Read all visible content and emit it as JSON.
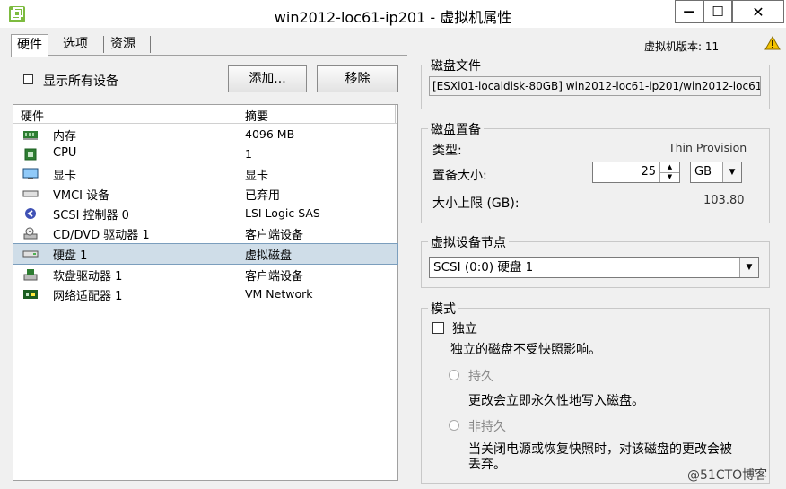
{
  "window": {
    "title": "win2012-loc61-ip201 - 虚拟机属性",
    "minimize_symbol": "—",
    "maximize_symbol": "☐",
    "close_symbol": "✕"
  },
  "tabs": [
    {
      "label": "硬件",
      "active": true
    },
    {
      "label": "选项",
      "active": false
    },
    {
      "label": "资源",
      "active": false
    }
  ],
  "vm_version": "虚拟机版本: 11",
  "show_all_devices": {
    "label": "显示所有设备",
    "checked": false
  },
  "buttons": {
    "add": "添加...",
    "remove": "移除"
  },
  "hardware_table": {
    "columns": [
      "硬件",
      "摘要"
    ],
    "rows": [
      {
        "name": "内存",
        "summary": "4096 MB",
        "icon": "memory-icon",
        "selected": false
      },
      {
        "name": "CPU",
        "summary": "1",
        "icon": "cpu-icon",
        "selected": false
      },
      {
        "name": "显卡",
        "summary": "显卡",
        "icon": "video-card-icon",
        "selected": false
      },
      {
        "name": "VMCI 设备",
        "summary": "已弃用",
        "icon": "vmci-icon",
        "selected": false
      },
      {
        "name": "SCSI 控制器 0",
        "summary": "LSI Logic SAS",
        "icon": "scsi-controller-icon",
        "selected": false
      },
      {
        "name": "CD/DVD 驱动器 1",
        "summary": "客户端设备",
        "icon": "cd-dvd-icon",
        "selected": false
      },
      {
        "name": "硬盘 1",
        "summary": "虚拟磁盘",
        "icon": "hard-disk-icon",
        "selected": true
      },
      {
        "name": "软盘驱动器 1",
        "summary": "客户端设备",
        "icon": "floppy-icon",
        "selected": false
      },
      {
        "name": "网络适配器 1",
        "summary": "VM Network",
        "icon": "network-adapter-icon",
        "selected": false
      }
    ]
  },
  "disk_file": {
    "group_label": "磁盘文件",
    "value": "[ESXi01-localdisk-80GB] win2012-loc61-ip201/win2012-loc61-"
  },
  "disk_provisioning": {
    "group_label": "磁盘置备",
    "type_label": "类型:",
    "type_value": "Thin Provision",
    "size_label": "置备大小:",
    "size_value": "25",
    "size_unit": "GB",
    "max_label": "大小上限 (GB):",
    "max_value": "103.80"
  },
  "virtual_device_node": {
    "group_label": "虚拟设备节点",
    "value": "SCSI (0:0) 硬盘 1"
  },
  "mode": {
    "group_label": "模式",
    "independent_label": "独立",
    "independent_checked": false,
    "independent_desc": "独立的磁盘不受快照影响。",
    "persistent_label": "持久",
    "persistent_desc": "更改会立即永久性地写入磁盘。",
    "nonpersistent_label": "非持久",
    "nonpersistent_desc_1": "当关闭电源或恢复快照时，对该磁盘的更改会被",
    "nonpersistent_desc_2": "丢弃。"
  },
  "watermark": "@51CTO博客"
}
